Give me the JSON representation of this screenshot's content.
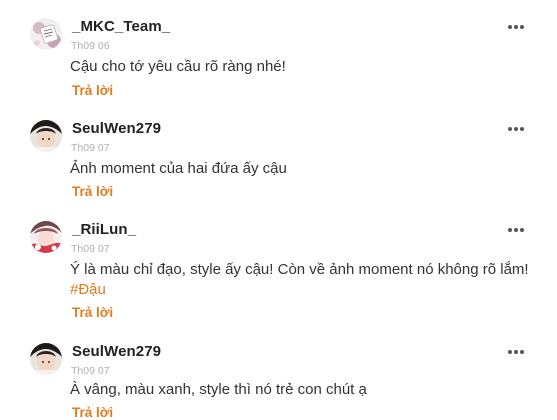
{
  "comments": [
    {
      "username": "_MKC_Team_",
      "date": "Th09 06",
      "text": "Cậu cho tớ yêu cầu rõ ràng nhé!",
      "reply_label": "Trả lời",
      "avatar": "avatar-mkc-team"
    },
    {
      "username": "SeulWen279",
      "date": "Th09 07",
      "text": "Ảnh moment của hai đứa ấy cậu",
      "reply_label": "Trả lời",
      "avatar": "avatar-seulwen"
    },
    {
      "username": "_RiiLun_",
      "date": "Th09 07",
      "text": "Ý là màu chỉ đạo, style ấy cậu! Còn về ảnh moment nó không rõ lắm!",
      "tag": "#Đậu",
      "reply_label": "Trả lời",
      "avatar": "avatar-riilun"
    },
    {
      "username": "SeulWen279",
      "date": "Th09 07",
      "text": "À vâng, màu xanh, style thì nó trẻ con chút ạ",
      "reply_label": "Trả lời",
      "avatar": "avatar-seulwen"
    }
  ],
  "icons": {
    "menu": "more-dots-icon"
  },
  "colors": {
    "accent": "#e07b1f",
    "date": "#b0b0b0",
    "text": "#333333"
  }
}
